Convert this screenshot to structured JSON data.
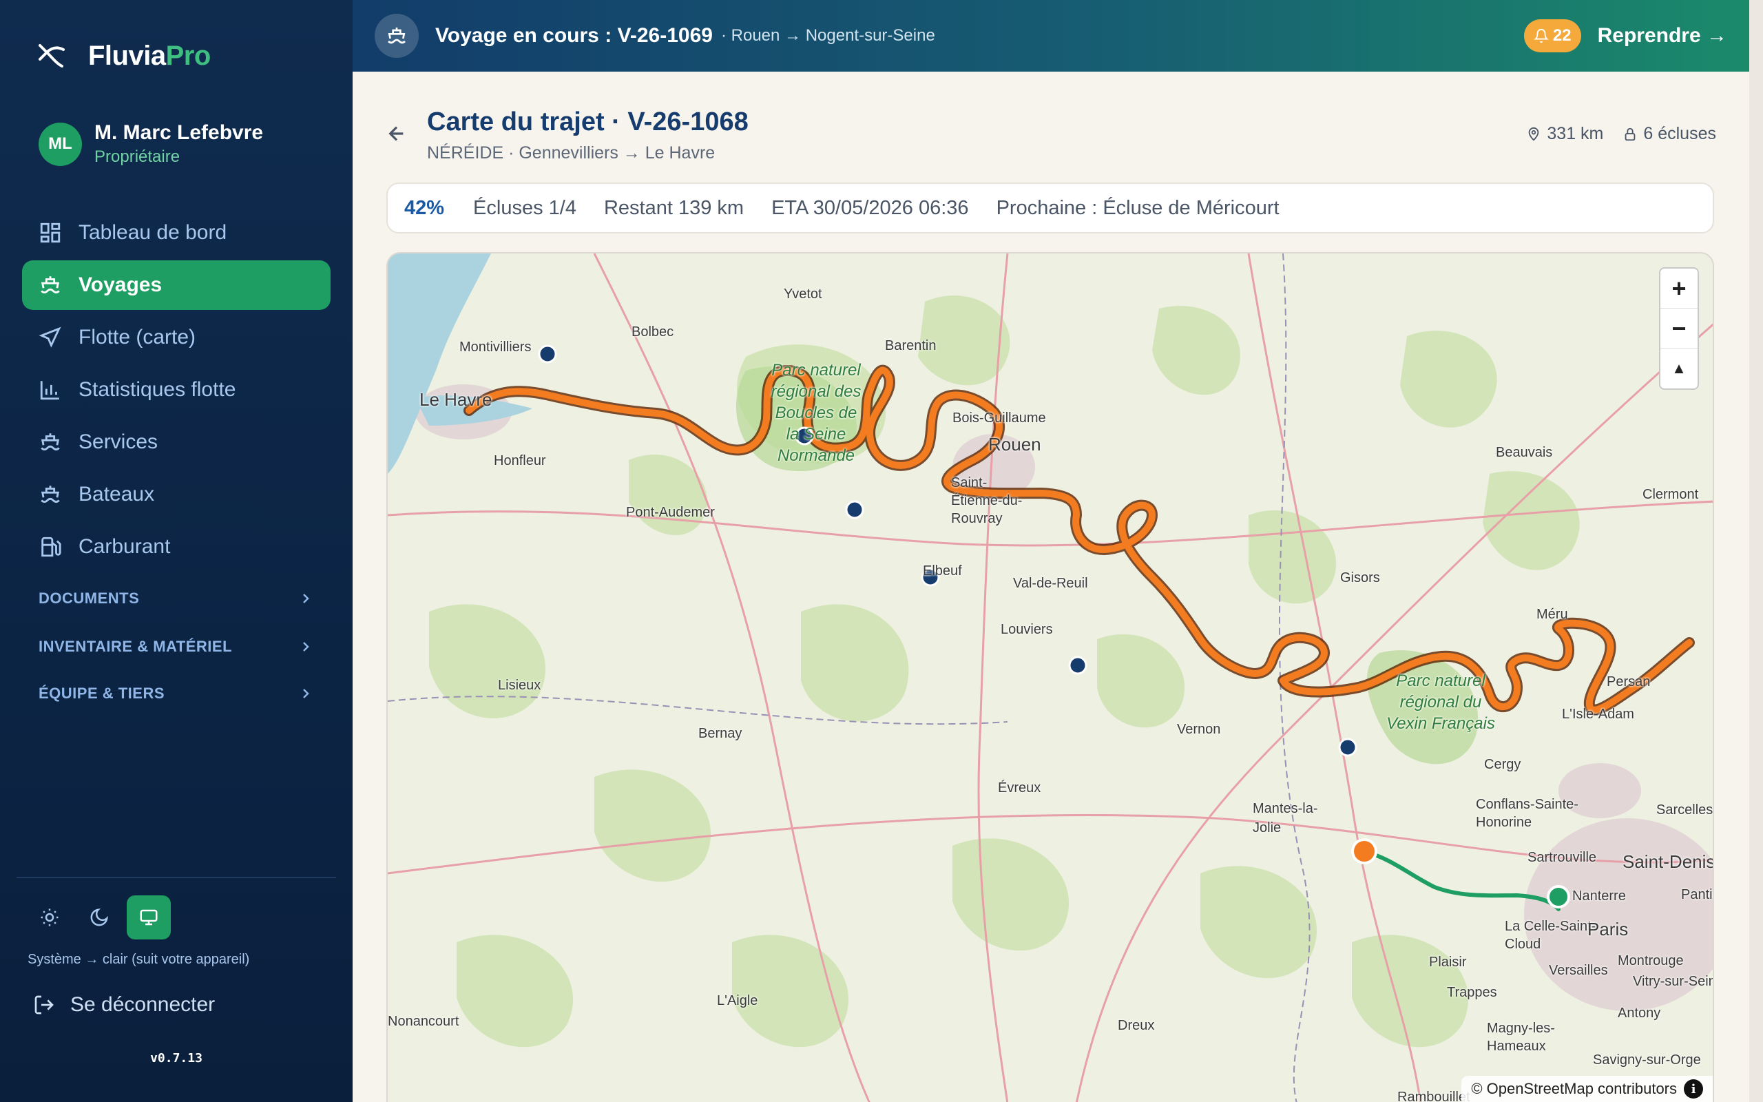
{
  "brand": {
    "name_main": "Fluvia",
    "name_accent": "Pro"
  },
  "user": {
    "initials": "ML",
    "name": "M. Marc Lefebvre",
    "role": "Propriétaire"
  },
  "nav": [
    {
      "label": "Tableau de bord",
      "icon": "dashboard-icon"
    },
    {
      "label": "Voyages",
      "icon": "ship-icon",
      "active": true
    },
    {
      "label": "Flotte (carte)",
      "icon": "navigation-icon"
    },
    {
      "label": "Statistiques flotte",
      "icon": "bar-chart-icon"
    },
    {
      "label": "Services",
      "icon": "ship-icon"
    },
    {
      "label": "Bateaux",
      "icon": "ship-icon"
    },
    {
      "label": "Carburant",
      "icon": "fuel-icon"
    }
  ],
  "sections": [
    "DOCUMENTS",
    "INVENTAIRE & MATÉRIEL",
    "ÉQUIPE & TIERS"
  ],
  "theme": {
    "caption": "Système → clair (suit votre appareil)",
    "active": "system"
  },
  "logout_label": "Se déconnecter",
  "version": "v0.7.13",
  "banner": {
    "prefix": "Voyage en cours :",
    "voyage_id": "V-26-1069",
    "route": "· Rouen → Nogent-sur-Seine",
    "notifications": "22",
    "resume_label": "Reprendre →"
  },
  "page": {
    "title": "Carte du trajet · V-26-1068",
    "subtitle": "NÉRÉIDE · Gennevilliers → Le Havre",
    "distance": "331 km",
    "locks": "6 écluses"
  },
  "progress": {
    "percent": "42%",
    "percent_value": 42,
    "locks": "Écluses 1/4",
    "remaining": "Restant 139 km",
    "eta": "ETA 30/05/2026 06:36",
    "next": "Prochaine : Écluse de Méricourt"
  },
  "map": {
    "attribution": "© OpenStreetMap contributors",
    "zoom_in": "+",
    "zoom_out": "−",
    "reset": "▲",
    "colors": {
      "route_planned": "#f47c20",
      "route_done": "#1e9e62",
      "lock_marker": "#163c6e",
      "current_position": "#f47c20"
    },
    "places": [
      "Yvetot",
      "Bolbec",
      "Montivilliers",
      "Le Havre",
      "Honfleur",
      "Barentin",
      "Bois-Guillaume",
      "Rouen",
      "Saint-Étienne-du-Rouvray",
      "Pont-Audemer",
      "Elbeuf",
      "Val-de-Reuil",
      "Louviers",
      "Gisors",
      "Beauvais",
      "Clermont",
      "Méru",
      "Persan",
      "L'Isle-Adam",
      "Lisieux",
      "Bernay",
      "Vernon",
      "Évreux",
      "Mantes-la-Jolie",
      "Cergy",
      "Conflans-Sainte-Honorine",
      "Sarcelles",
      "Sartrouville",
      "Saint-Denis",
      "Nanterre",
      "La Celle-Saint-Cloud",
      "Paris",
      "Pantin",
      "Versailles",
      "Plaisir",
      "Montrouge",
      "Vitry-sur-Seine",
      "Trappes",
      "Magny-les-Hameaux",
      "Antony",
      "L'Aigle",
      "Dreux",
      "Nonancourt",
      "Rambouillet",
      "Savigny-sur-Orge"
    ],
    "parks": [
      "Parc naturel régional des Boucles de la Seine Normande",
      "Parc naturel régional du Vexin Français"
    ]
  }
}
